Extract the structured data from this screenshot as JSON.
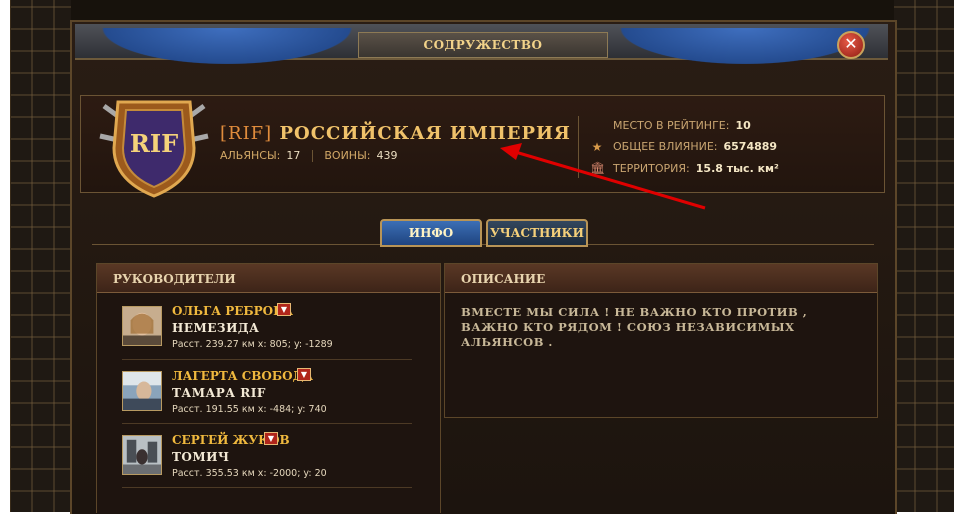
{
  "window": {
    "title": "СОДРУЖЕСТВО",
    "close_icon": "close-icon"
  },
  "alliance": {
    "emblem_text": "RIF",
    "tag": "[RIF]",
    "name": "РОССИЙСКАЯ ИМПЕРИЯ",
    "alliances_label": "АЛЬЯНСЫ:",
    "alliances_value": "17",
    "warriors_label": "ВОИНЫ:",
    "warriors_value": "439",
    "rank_label": "МЕСТО В РЕЙТИНГЕ:",
    "rank_value": "10",
    "influence_label": "ОБЩЕЕ ВЛИЯНИЕ:",
    "influence_value": "6574889",
    "territory_label": "ТЕРРИТОРИЯ:",
    "territory_value": "15.8 тыс. км²"
  },
  "tabs": [
    {
      "label": "ИНФО",
      "active": true
    },
    {
      "label": "УЧАСТНИКИ",
      "active": false
    }
  ],
  "leaders": {
    "heading": "РУКОВОДИТЕЛИ",
    "items": [
      {
        "name": "ОЛЬГА РЕБРОВА",
        "title": "НЕМЕЗИДА",
        "coords": "Расст. 239.27 км  x: 805; y: -1289"
      },
      {
        "name": "ЛАГЕРТА СВОБОДА",
        "title": "ТАМАРА RIF",
        "coords": "Расст. 191.55 км  x: -484; y: 740"
      },
      {
        "name": "СЕРГЕЙ ЖУКОВ",
        "title": "ТОМИЧ",
        "coords": "Расст. 355.53 км  x: -2000; y: 20"
      }
    ]
  },
  "description": {
    "heading": "ОПИСАНИЕ",
    "text": "ВМЕСТЕ МЫ СИЛА ! НЕ ВАЖНО  КТО ПРОТИВ , ВАЖНО КТО РЯДОМ ! СОЮЗ НЕЗАВИСИМЫХ АЛЬЯНСОВ ."
  },
  "colors": {
    "accent_gold": "#f0b93e",
    "active_tab": "#2f5ea3",
    "annotation_arrow": "#e00000"
  }
}
